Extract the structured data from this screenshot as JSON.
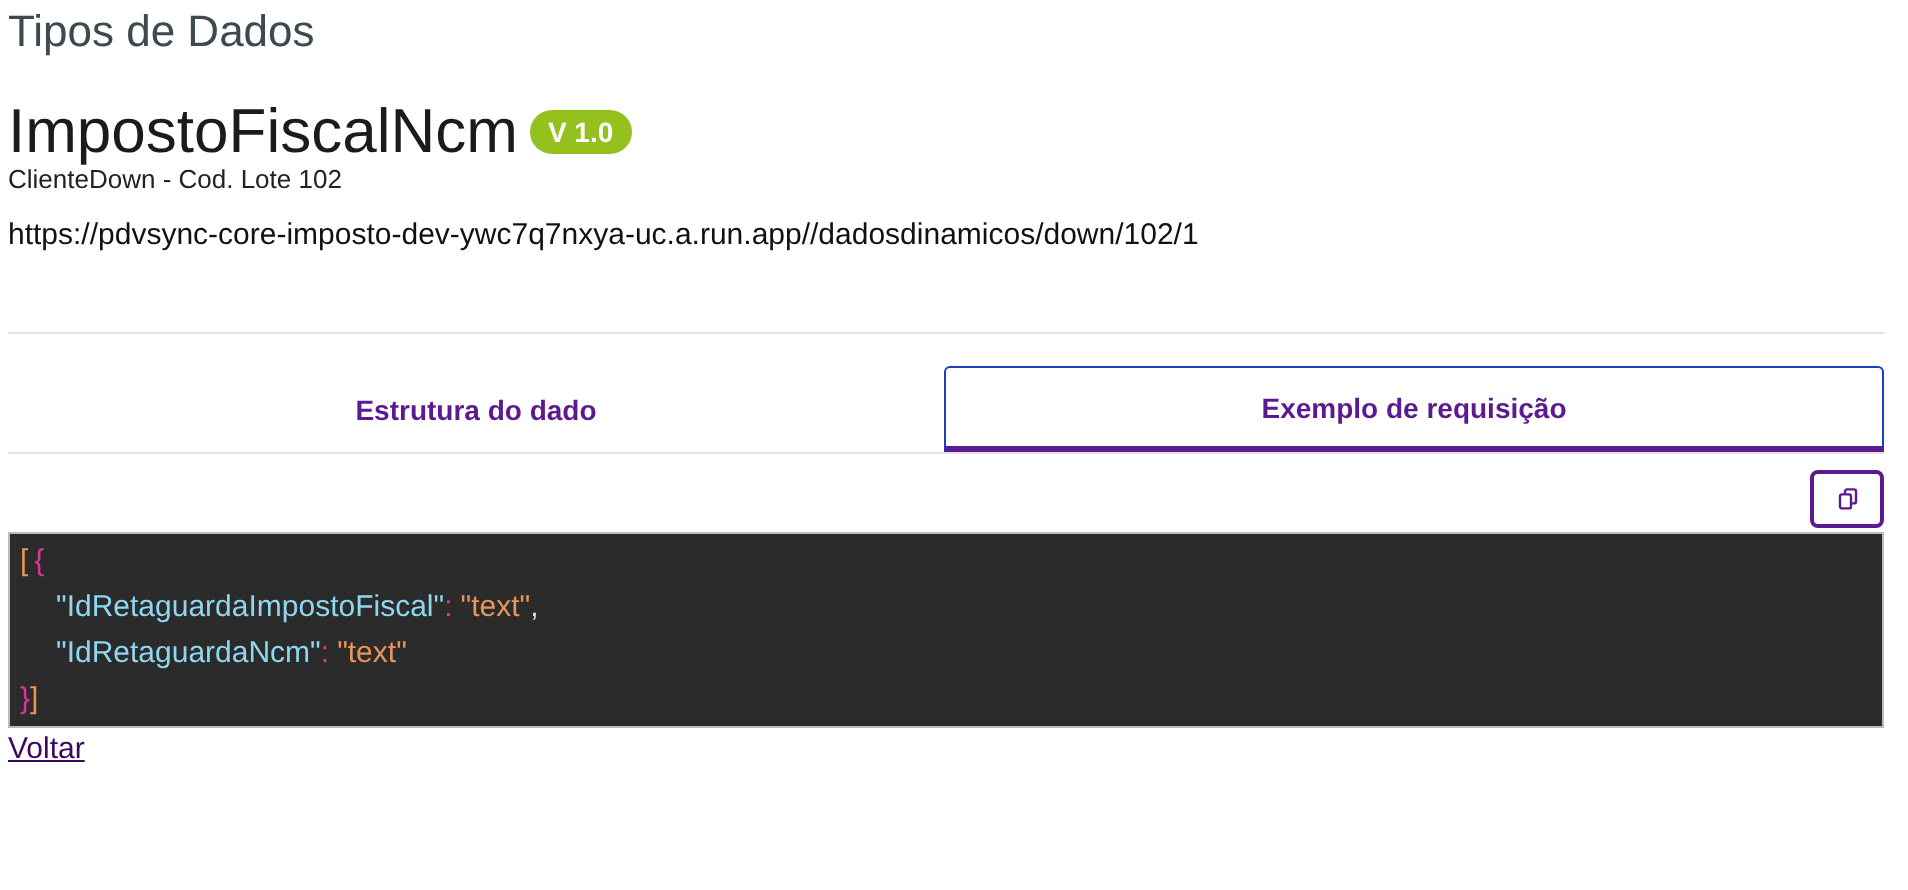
{
  "page_title": "Tipos de Dados",
  "heading": {
    "title": "ImpostoFiscalNcm",
    "version_badge": "V 1.0"
  },
  "subtitle": "ClienteDown - Cod. Lote 102",
  "url": "https://pdvsync-core-imposto-dev-ywc7q7nxya-uc.a.run.app//dadosdinamicos/down/102/1",
  "tabs": [
    {
      "label": "Estrutura do dado",
      "selected": false
    },
    {
      "label": "Exemplo de requisição",
      "selected": true
    }
  ],
  "code": {
    "lines": [
      {
        "indented": false,
        "tokens": [
          {
            "kind": "bracket",
            "text": "["
          },
          {
            "kind": "brace",
            "text": "{"
          }
        ]
      },
      {
        "indented": true,
        "tokens": [
          {
            "kind": "key",
            "text": "\"IdRetaguardaImpostoFiscal\""
          },
          {
            "kind": "colon",
            "text": ":"
          },
          {
            "kind": "string",
            "text": "\"text\""
          },
          {
            "kind": "comma",
            "text": ","
          }
        ]
      },
      {
        "indented": true,
        "tokens": [
          {
            "kind": "key",
            "text": "\"IdRetaguardaNcm\""
          },
          {
            "kind": "colon",
            "text": ":"
          },
          {
            "kind": "string",
            "text": "\"text\""
          }
        ]
      },
      {
        "indented": false,
        "tokens": [
          {
            "kind": "brace",
            "text": "}"
          },
          {
            "kind": "bracket",
            "text": "]"
          }
        ]
      }
    ]
  },
  "back_link": "Voltar"
}
